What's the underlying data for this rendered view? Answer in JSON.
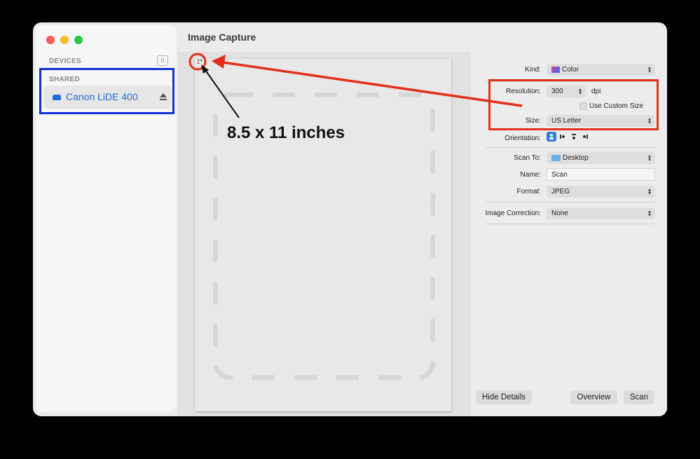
{
  "window": {
    "title": "Image Capture"
  },
  "sidebar": {
    "devices_header": "DEVICES",
    "devices_count": "0",
    "shared_header": "SHARED",
    "device": {
      "name": "Canon LiDE 400",
      "icon": "scanner-icon",
      "action_icon": "eject-icon"
    }
  },
  "preview": {
    "callout_text": "8.5 x 11 inches"
  },
  "settings": {
    "kind": {
      "label": "Kind:",
      "value": "Color",
      "icon": "color-icon"
    },
    "resolution": {
      "label": "Resolution:",
      "value": "300",
      "unit": "dpi"
    },
    "custom_size": {
      "label": "Use Custom Size",
      "checked": false
    },
    "size": {
      "label": "Size:",
      "value": "US Letter"
    },
    "orientation": {
      "label": "Orientation:",
      "selected_index": 0
    },
    "scan_to": {
      "label": "Scan To:",
      "value": "Desktop",
      "icon": "folder-icon"
    },
    "name": {
      "label": "Name:",
      "value": "Scan"
    },
    "format": {
      "label": "Format:",
      "value": "JPEG"
    },
    "image_correction": {
      "label": "Image Correction:",
      "value": "None"
    }
  },
  "buttons": {
    "hide_details": "Hide Details",
    "overview": "Overview",
    "scan": "Scan"
  },
  "colors": {
    "annotation_red": "#e2301b",
    "annotation_blue": "#1231d6",
    "accent_blue": "#1c6fd3"
  }
}
